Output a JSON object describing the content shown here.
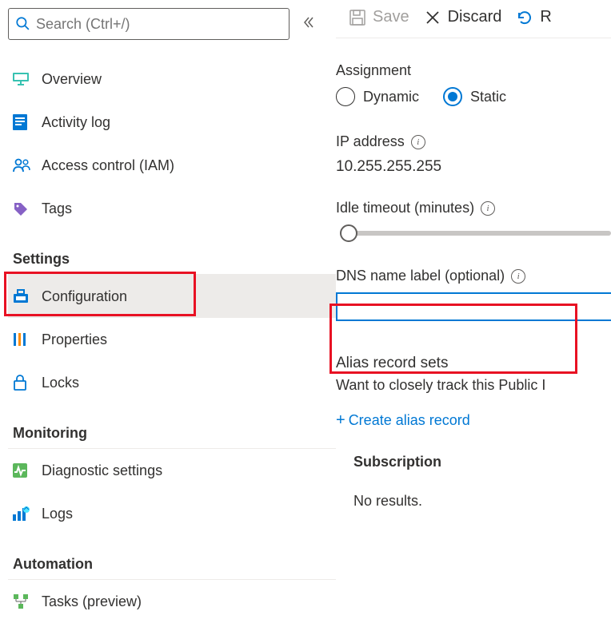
{
  "sidebar": {
    "search_placeholder": "Search (Ctrl+/)",
    "items": [
      {
        "label": "Overview",
        "icon": "overview-icon"
      },
      {
        "label": "Activity log",
        "icon": "activitylog-icon"
      },
      {
        "label": "Access control (IAM)",
        "icon": "iam-icon"
      },
      {
        "label": "Tags",
        "icon": "tag-icon"
      }
    ],
    "sections": [
      {
        "heading": "Settings",
        "items": [
          {
            "label": "Configuration",
            "icon": "config-icon",
            "selected": true
          },
          {
            "label": "Properties",
            "icon": "properties-icon"
          },
          {
            "label": "Locks",
            "icon": "lock-icon"
          }
        ]
      },
      {
        "heading": "Monitoring",
        "items": [
          {
            "label": "Diagnostic settings",
            "icon": "diagnostic-icon"
          },
          {
            "label": "Logs",
            "icon": "logs-icon"
          }
        ]
      },
      {
        "heading": "Automation",
        "items": [
          {
            "label": "Tasks (preview)",
            "icon": "tasks-icon"
          }
        ]
      }
    ]
  },
  "toolbar": {
    "save_label": "Save",
    "discard_label": "Discard",
    "refresh_label": "R"
  },
  "form": {
    "assignment_label": "Assignment",
    "assignment_options": {
      "dynamic": "Dynamic",
      "static": "Static"
    },
    "assignment_value": "Static",
    "ip_label": "IP address",
    "ip_value": "10.255.255.255",
    "idle_label": "Idle timeout (minutes)",
    "dns_label": "DNS name label (optional)",
    "dns_value": "",
    "alias_heading": "Alias record sets",
    "alias_desc": "Want to closely track this Public I",
    "create_alias_label": "Create alias record",
    "subscription_heading": "Subscription",
    "no_results": "No results."
  },
  "colors": {
    "accent": "#0078d4",
    "highlight": "#e81123"
  }
}
